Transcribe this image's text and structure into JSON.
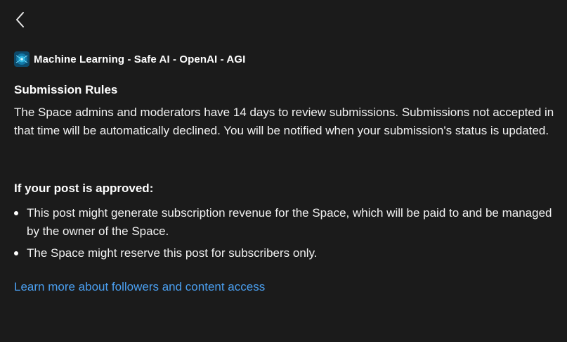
{
  "navigation": {
    "back_icon": "chevron-left-icon"
  },
  "space": {
    "avatar_icon": "space-avatar-image",
    "name": "Machine Learning - Safe AI - OpenAI - AGI"
  },
  "submission_rules": {
    "heading": "Submission Rules",
    "text": "The Space admins and moderators have 14 days to review submissions. Submissions not accepted in that time will be automatically declined. You will be notified when your submission's status is updated."
  },
  "approval": {
    "heading": "If your post is approved:",
    "bullets": [
      "This post might generate subscription revenue for the Space, which will be paid to and be managed by the owner of the Space.",
      "The Space might reserve this post for subscribers only."
    ]
  },
  "learn_more_link": "Learn more about followers and content access",
  "colors": {
    "background": "#1b1b1b",
    "text": "#ffffff",
    "link": "#4a9ff0"
  }
}
